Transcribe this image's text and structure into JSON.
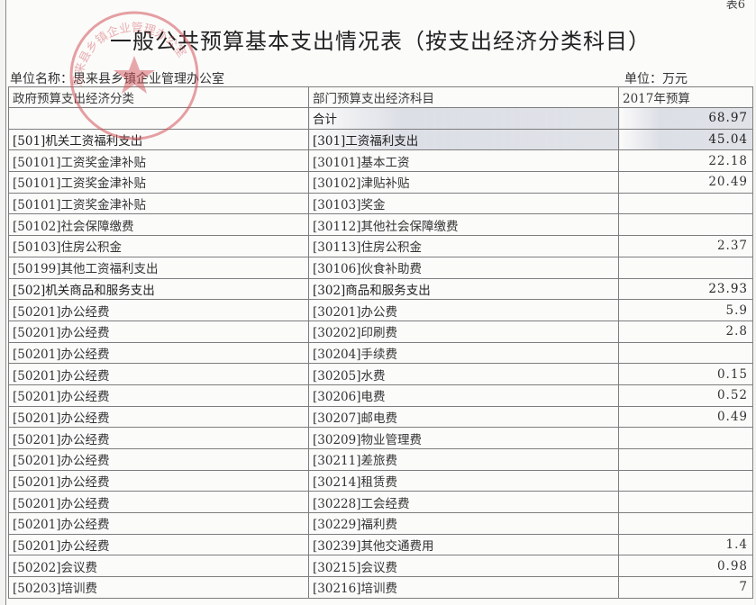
{
  "page_number": "表6",
  "title": "一般公共预算基本支出情况表（按支出经济分类科目）",
  "unit_label": "单位名称：",
  "unit_name": "思来县乡镇企业管理办公室",
  "currency_label": "单位：万元",
  "stamp_text": "思来县乡镇企业管理办公室",
  "stamp_color": "#d3535a",
  "headers": {
    "gov_category": "政府预算支出经济分类",
    "dept_category": "部门预算支出经济科目",
    "budget_year": "2017年预算"
  },
  "rows": [
    {
      "gov": "",
      "dept": "合计",
      "amount": "68.97"
    },
    {
      "gov": "[501]机关工资福利支出",
      "dept": "[301]工资福利支出",
      "amount": "45.04"
    },
    {
      "gov": "[50101]工资奖金津补贴",
      "dept": "[30101]基本工资",
      "amount": "22.18"
    },
    {
      "gov": "[50101]工资奖金津补贴",
      "dept": "[30102]津贴补贴",
      "amount": "20.49"
    },
    {
      "gov": "[50101]工资奖金津补贴",
      "dept": "[30103]奖金",
      "amount": ""
    },
    {
      "gov": "[50102]社会保障缴费",
      "dept": "[30112]其他社会保障缴费",
      "amount": ""
    },
    {
      "gov": "[50103]住房公积金",
      "dept": "[30113]住房公积金",
      "amount": "2.37"
    },
    {
      "gov": "[50199]其他工资福利支出",
      "dept": "[30106]伙食补助费",
      "amount": ""
    },
    {
      "gov": "[502]机关商品和服务支出",
      "dept": "[302]商品和服务支出",
      "amount": "23.93"
    },
    {
      "gov": "[50201]办公经费",
      "dept": "[30201]办公费",
      "amount": "5.9"
    },
    {
      "gov": "[50201]办公经费",
      "dept": "[30202]印刷费",
      "amount": "2.8"
    },
    {
      "gov": "[50201]办公经费",
      "dept": "[30204]手续费",
      "amount": ""
    },
    {
      "gov": "[50201]办公经费",
      "dept": "[30205]水费",
      "amount": "0.15"
    },
    {
      "gov": "[50201]办公经费",
      "dept": "[30206]电费",
      "amount": "0.52"
    },
    {
      "gov": "[50201]办公经费",
      "dept": "[30207]邮电费",
      "amount": "0.49"
    },
    {
      "gov": "[50201]办公经费",
      "dept": "[30209]物业管理费",
      "amount": ""
    },
    {
      "gov": "[50201]办公经费",
      "dept": "[30211]差旅费",
      "amount": ""
    },
    {
      "gov": "[50201]办公经费",
      "dept": "[30214]租赁费",
      "amount": ""
    },
    {
      "gov": "[50201]办公经费",
      "dept": "[30228]工会经费",
      "amount": ""
    },
    {
      "gov": "[50201]办公经费",
      "dept": "[30229]福利费",
      "amount": ""
    },
    {
      "gov": "[50201]办公经费",
      "dept": "[30239]其他交通费用",
      "amount": "1.4"
    },
    {
      "gov": "[50202]会议费",
      "dept": "[30215]会议费",
      "amount": "0.98"
    },
    {
      "gov": "[50203]培训费",
      "dept": "[30216]培训费",
      "amount": "7"
    }
  ]
}
